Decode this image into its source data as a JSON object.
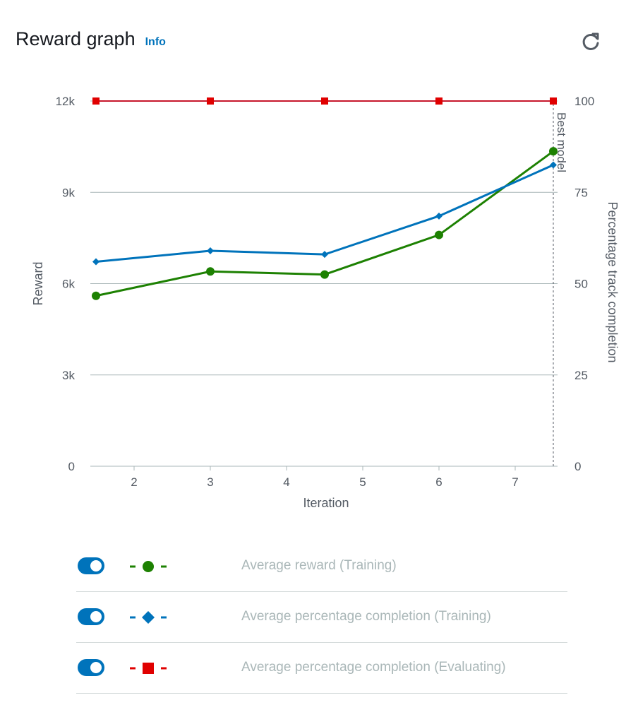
{
  "header": {
    "title": "Reward graph",
    "info_label": "Info"
  },
  "chart_data": {
    "type": "line",
    "xlabel": "Iteration",
    "ylabel": "Reward",
    "y2label": "Percentage track completion",
    "annotation": "Best model",
    "annotation_x": 7.5,
    "xlim": [
      1.5,
      7.5
    ],
    "xticks": [
      2,
      3,
      4,
      5,
      6,
      7
    ],
    "ylim": [
      0,
      12000
    ],
    "yticks": [
      0,
      3000,
      6000,
      9000,
      12000
    ],
    "ytick_labels": [
      "0",
      "3k",
      "6k",
      "9k",
      "12k"
    ],
    "y2lim": [
      0,
      100
    ],
    "y2ticks": [
      0,
      25,
      50,
      75,
      100
    ],
    "y2tick_labels": [
      "0",
      "25",
      "50",
      "75",
      "100"
    ],
    "grid": true,
    "series": [
      {
        "name": "Average reward (Training)",
        "axis": "left",
        "marker": "circle",
        "color": "#1d8102",
        "x": [
          1.5,
          3,
          4.5,
          6,
          7.5
        ],
        "y": [
          5600,
          6400,
          6300,
          7600,
          10350
        ]
      },
      {
        "name": "Average percentage completion (Training)",
        "axis": "right",
        "marker": "diamond",
        "color": "#0073bb",
        "x": [
          1.5,
          3,
          4.5,
          6,
          7.5
        ],
        "y": [
          56,
          59,
          58,
          68.5,
          82.5
        ]
      },
      {
        "name": "Average percentage completion (Evaluating)",
        "axis": "right",
        "marker": "square",
        "color": "#d13212",
        "x": [
          1.5,
          3,
          4.5,
          6,
          7.5
        ],
        "y": [
          100,
          100,
          100,
          100,
          100
        ]
      }
    ]
  },
  "legend": [
    {
      "label": "Average reward (Training)",
      "enabled": true,
      "color": "#1d8102",
      "marker": "circle"
    },
    {
      "label": "Average percentage completion (Training)",
      "enabled": true,
      "color": "#0073bb",
      "marker": "diamond"
    },
    {
      "label": "Average percentage completion (Evaluating)",
      "enabled": true,
      "color": "#d13212",
      "marker": "square"
    }
  ],
  "icons": {
    "refresh": "refresh-icon"
  }
}
